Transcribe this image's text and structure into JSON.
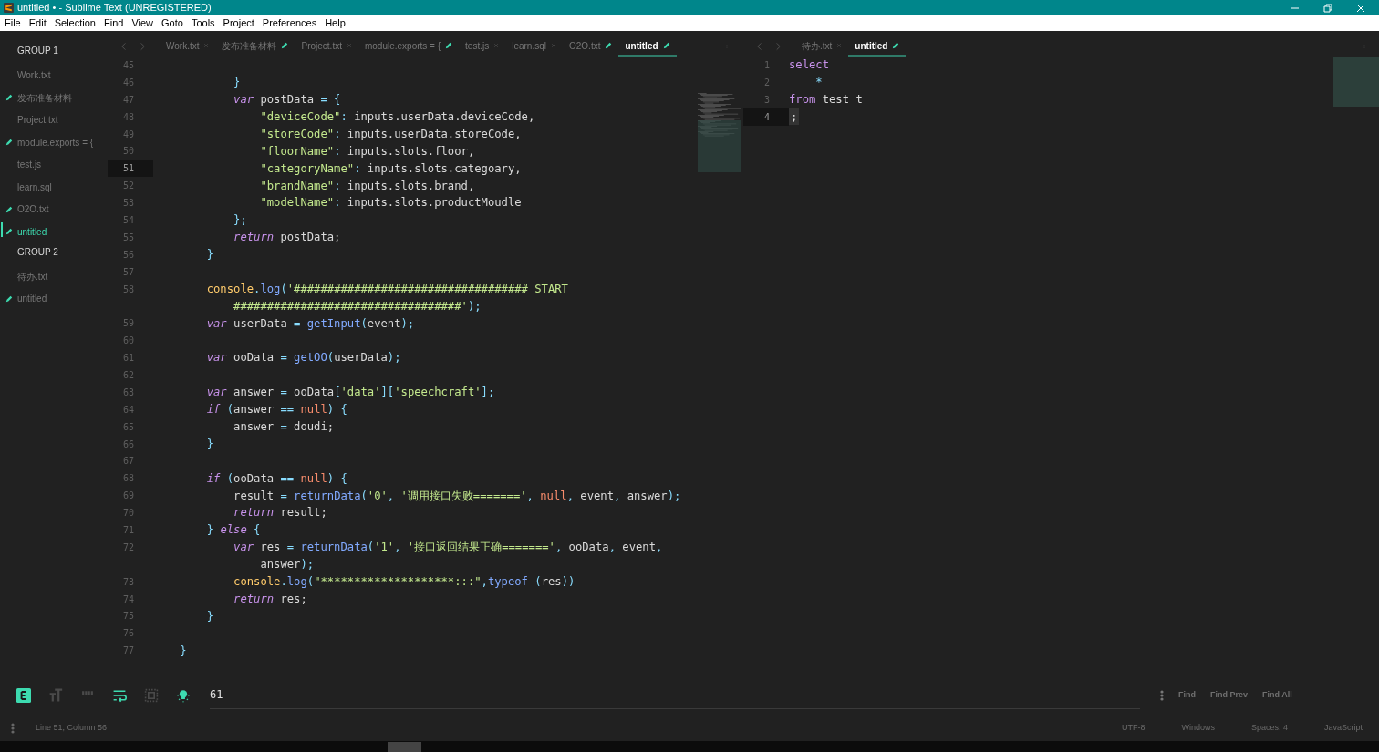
{
  "window": {
    "title": "untitled • - Sublime Text (UNREGISTERED)"
  },
  "menu": [
    "File",
    "Edit",
    "Selection",
    "Find",
    "View",
    "Goto",
    "Tools",
    "Project",
    "Preferences",
    "Help"
  ],
  "sidebar": {
    "groups": [
      {
        "title": "GROUP 1",
        "items": [
          {
            "label": "Work.txt",
            "modified": false,
            "selected": false
          },
          {
            "label": "发布准备材料",
            "modified": true,
            "selected": false
          },
          {
            "label": "Project.txt",
            "modified": false,
            "selected": false
          },
          {
            "label": "module.exports = {",
            "modified": true,
            "selected": false
          },
          {
            "label": "test.js",
            "modified": false,
            "selected": false
          },
          {
            "label": "learn.sql",
            "modified": false,
            "selected": false
          },
          {
            "label": "O2O.txt",
            "modified": true,
            "selected": false
          },
          {
            "label": "untitled",
            "modified": true,
            "selected": true
          }
        ]
      },
      {
        "title": "GROUP 2",
        "items": [
          {
            "label": "待办.txt",
            "modified": false,
            "selected": false
          },
          {
            "label": "untitled",
            "modified": true,
            "selected": false
          }
        ]
      }
    ]
  },
  "panes": [
    {
      "tabs": [
        {
          "label": "Work.txt",
          "modified": false,
          "selected": false
        },
        {
          "label": "发布准备材料",
          "modified": true,
          "selected": false
        },
        {
          "label": "Project.txt",
          "modified": false,
          "selected": false
        },
        {
          "label": "module.exports = {",
          "modified": true,
          "selected": false
        },
        {
          "label": "test.js",
          "modified": false,
          "selected": false
        },
        {
          "label": "learn.sql",
          "modified": false,
          "selected": false
        },
        {
          "label": "O2O.txt",
          "modified": true,
          "selected": false
        },
        {
          "label": "untitled",
          "modified": true,
          "selected": true
        }
      ],
      "lines": [
        {
          "n": "45",
          "current": false
        },
        {
          "n": "46",
          "current": false,
          "tokens": [
            {
              "kind": "p",
              "text": "            }"
            }
          ]
        },
        {
          "n": "47",
          "current": false,
          "tokens": [
            {
              "kind": "k",
              "text": "            var"
            },
            {
              "kind": "t",
              "text": " postData "
            },
            {
              "kind": "p",
              "text": "= {"
            }
          ]
        },
        {
          "n": "48",
          "current": false,
          "tokens": [
            {
              "kind": "s",
              "text": "                \"deviceCode\""
            },
            {
              "kind": "p",
              "text": ":"
            },
            {
              "kind": "t",
              "text": " inputs.userData.deviceCode,"
            }
          ]
        },
        {
          "n": "49",
          "current": false,
          "tokens": [
            {
              "kind": "s",
              "text": "                \"storeCode\""
            },
            {
              "kind": "p",
              "text": ":"
            },
            {
              "kind": "t",
              "text": " inputs.userData.storeCode,"
            }
          ]
        },
        {
          "n": "50",
          "current": false,
          "tokens": [
            {
              "kind": "s",
              "text": "                \"floorName\""
            },
            {
              "kind": "p",
              "text": ":"
            },
            {
              "kind": "t",
              "text": " inputs.slots.floor,"
            }
          ]
        },
        {
          "n": "51",
          "current": true,
          "tokens": [
            {
              "kind": "s",
              "text": "                \"categoryName\""
            },
            {
              "kind": "p",
              "text": ":"
            },
            {
              "kind": "t",
              "text": " inputs.slots.categoary,"
            }
          ]
        },
        {
          "n": "52",
          "current": false,
          "tokens": [
            {
              "kind": "s",
              "text": "                \"brandName\""
            },
            {
              "kind": "p",
              "text": ":"
            },
            {
              "kind": "t",
              "text": " inputs.slots.brand,"
            }
          ]
        },
        {
          "n": "53",
          "current": false,
          "tokens": [
            {
              "kind": "s",
              "text": "                \"modelName\""
            },
            {
              "kind": "p",
              "text": ":"
            },
            {
              "kind": "t",
              "text": " inputs.slots.productMoudle"
            }
          ]
        },
        {
          "n": "54",
          "current": false,
          "tokens": [
            {
              "kind": "p",
              "text": "            };"
            }
          ]
        },
        {
          "n": "55",
          "current": false,
          "tokens": [
            {
              "kind": "k",
              "text": "            return"
            },
            {
              "kind": "t",
              "text": " postData;"
            }
          ]
        },
        {
          "n": "56",
          "current": false,
          "tokens": [
            {
              "kind": "p",
              "text": "        }"
            }
          ]
        },
        {
          "n": "57",
          "current": false
        },
        {
          "n": "58",
          "current": false,
          "tokens": [
            {
              "kind": "c",
              "text": "        console"
            },
            {
              "kind": "p",
              "text": "."
            },
            {
              "kind": "f",
              "text": "log"
            },
            {
              "kind": "p",
              "text": "("
            },
            {
              "kind": "s",
              "text": "'################################### START"
            }
          ]
        },
        {
          "tokens": [
            {
              "kind": "s",
              "text": "            ##################################'"
            },
            {
              "kind": "p",
              "text": ");"
            }
          ]
        },
        {
          "n": "59",
          "current": false,
          "tokens": [
            {
              "kind": "k",
              "text": "        var"
            },
            {
              "kind": "t",
              "text": " userData "
            },
            {
              "kind": "p",
              "text": "="
            },
            {
              "kind": "f",
              "text": " getInput"
            },
            {
              "kind": "p",
              "text": "("
            },
            {
              "kind": "t",
              "text": "event"
            },
            {
              "kind": "p",
              "text": ");"
            }
          ]
        },
        {
          "n": "60",
          "current": false
        },
        {
          "n": "61",
          "current": false,
          "tokens": [
            {
              "kind": "k",
              "text": "        var"
            },
            {
              "kind": "t",
              "text": " ooData "
            },
            {
              "kind": "p",
              "text": "="
            },
            {
              "kind": "f",
              "text": " getOO"
            },
            {
              "kind": "p",
              "text": "("
            },
            {
              "kind": "t",
              "text": "userData"
            },
            {
              "kind": "p",
              "text": ");"
            }
          ]
        },
        {
          "n": "62",
          "current": false
        },
        {
          "n": "63",
          "current": false,
          "tokens": [
            {
              "kind": "k",
              "text": "        var"
            },
            {
              "kind": "t",
              "text": " answer "
            },
            {
              "kind": "p",
              "text": "="
            },
            {
              "kind": "t",
              "text": " ooData"
            },
            {
              "kind": "p",
              "text": "["
            },
            {
              "kind": "s",
              "text": "'data'"
            },
            {
              "kind": "p",
              "text": "]["
            },
            {
              "kind": "s",
              "text": "'speechcraft'"
            },
            {
              "kind": "p",
              "text": "];"
            }
          ]
        },
        {
          "n": "64",
          "current": false,
          "tokens": [
            {
              "kind": "k",
              "text": "        if"
            },
            {
              "kind": "p",
              "text": " ("
            },
            {
              "kind": "t",
              "text": "answer "
            },
            {
              "kind": "p",
              "text": "=="
            },
            {
              "kind": "n",
              "text": " null"
            },
            {
              "kind": "p",
              "text": ") {"
            }
          ]
        },
        {
          "n": "65",
          "current": false,
          "tokens": [
            {
              "kind": "t",
              "text": "            answer "
            },
            {
              "kind": "p",
              "text": "="
            },
            {
              "kind": "t",
              "text": " doudi;"
            }
          ]
        },
        {
          "n": "66",
          "current": false,
          "tokens": [
            {
              "kind": "p",
              "text": "        }"
            }
          ]
        },
        {
          "n": "67",
          "current": false
        },
        {
          "n": "68",
          "current": false,
          "tokens": [
            {
              "kind": "k",
              "text": "        if"
            },
            {
              "kind": "p",
              "text": " ("
            },
            {
              "kind": "t",
              "text": "ooData "
            },
            {
              "kind": "p",
              "text": "=="
            },
            {
              "kind": "n",
              "text": " null"
            },
            {
              "kind": "p",
              "text": ") {"
            }
          ]
        },
        {
          "n": "69",
          "current": false,
          "tokens": [
            {
              "kind": "t",
              "text": "            result "
            },
            {
              "kind": "p",
              "text": "="
            },
            {
              "kind": "f",
              "text": " returnData"
            },
            {
              "kind": "p",
              "text": "("
            },
            {
              "kind": "s",
              "text": "'0'"
            },
            {
              "kind": "p",
              "text": ", "
            },
            {
              "kind": "s",
              "text": "'调用接口失败======='"
            },
            {
              "kind": "p",
              "text": ", "
            },
            {
              "kind": "n",
              "text": "null"
            },
            {
              "kind": "p",
              "text": ", "
            },
            {
              "kind": "t",
              "text": "event"
            },
            {
              "kind": "p",
              "text": ", "
            },
            {
              "kind": "t",
              "text": "answer"
            },
            {
              "kind": "p",
              "text": ");"
            }
          ]
        },
        {
          "n": "70",
          "current": false,
          "tokens": [
            {
              "kind": "k",
              "text": "            return"
            },
            {
              "kind": "t",
              "text": " result;"
            }
          ]
        },
        {
          "n": "71",
          "current": false,
          "tokens": [
            {
              "kind": "p",
              "text": "        } "
            },
            {
              "kind": "k",
              "text": "else"
            },
            {
              "kind": "p",
              "text": " {"
            }
          ]
        },
        {
          "n": "72",
          "current": false,
          "tokens": [
            {
              "kind": "k",
              "text": "            var"
            },
            {
              "kind": "t",
              "text": " res "
            },
            {
              "kind": "p",
              "text": "="
            },
            {
              "kind": "f",
              "text": " returnData"
            },
            {
              "kind": "p",
              "text": "("
            },
            {
              "kind": "s",
              "text": "'1'"
            },
            {
              "kind": "p",
              "text": ", "
            },
            {
              "kind": "s",
              "text": "'接口返回结果正确======='"
            },
            {
              "kind": "p",
              "text": ", "
            },
            {
              "kind": "t",
              "text": "ooData"
            },
            {
              "kind": "p",
              "text": ", "
            },
            {
              "kind": "t",
              "text": "event"
            },
            {
              "kind": "p",
              "text": ","
            }
          ]
        },
        {
          "tokens": [
            {
              "kind": "t",
              "text": "                answer"
            },
            {
              "kind": "p",
              "text": ");"
            }
          ]
        },
        {
          "n": "73",
          "current": false,
          "tokens": [
            {
              "kind": "c",
              "text": "            console"
            },
            {
              "kind": "p",
              "text": "."
            },
            {
              "kind": "f",
              "text": "log"
            },
            {
              "kind": "p",
              "text": "("
            },
            {
              "kind": "s",
              "text": "\"********************:::\""
            },
            {
              "kind": "p",
              "text": ","
            },
            {
              "kind": "f",
              "text": "typeof"
            },
            {
              "kind": "p",
              "text": " ("
            },
            {
              "kind": "t",
              "text": "res"
            },
            {
              "kind": "p",
              "text": "))"
            }
          ]
        },
        {
          "n": "74",
          "current": false,
          "tokens": [
            {
              "kind": "k",
              "text": "            return"
            },
            {
              "kind": "t",
              "text": " res;"
            }
          ]
        },
        {
          "n": "75",
          "current": false,
          "tokens": [
            {
              "kind": "p",
              "text": "        }"
            }
          ]
        },
        {
          "n": "76",
          "current": false
        },
        {
          "n": "77",
          "current": false,
          "tokens": [
            {
              "kind": "p",
              "text": "    }"
            }
          ]
        }
      ]
    },
    {
      "tabs": [
        {
          "label": "待办.txt",
          "modified": false,
          "selected": false
        },
        {
          "label": "untitled",
          "modified": true,
          "selected": true
        }
      ],
      "lines": [
        {
          "n": "1",
          "current": false,
          "tokens": [
            {
              "kind": "q",
              "text": "select"
            }
          ]
        },
        {
          "n": "2",
          "current": false,
          "tokens": [
            {
              "kind": "p",
              "text": "    *"
            }
          ]
        },
        {
          "n": "3",
          "current": false,
          "tokens": [
            {
              "kind": "q",
              "text": "from"
            },
            {
              "kind": "t",
              "text": " test t"
            }
          ]
        },
        {
          "n": "4",
          "current": true,
          "tokens": [
            {
              "kind": "t",
              "text": ";"
            }
          ]
        }
      ]
    }
  ],
  "find_panel": {
    "toggles": [
      {
        "kind": "regex",
        "on": true
      },
      {
        "kind": "case",
        "on": false
      },
      {
        "kind": "word",
        "on": false
      },
      {
        "kind": "wrap",
        "on": true
      },
      {
        "kind": "selection",
        "on": false
      },
      {
        "kind": "highlight",
        "on": true
      }
    ],
    "value": "61",
    "buttons": [
      "Find",
      "Find Prev",
      "Find All"
    ]
  },
  "status_bar": {
    "position": "Line 51, Column 56",
    "items": [
      "UTF-8",
      "Windows",
      "Spaces: 4",
      "JavaScript"
    ]
  }
}
